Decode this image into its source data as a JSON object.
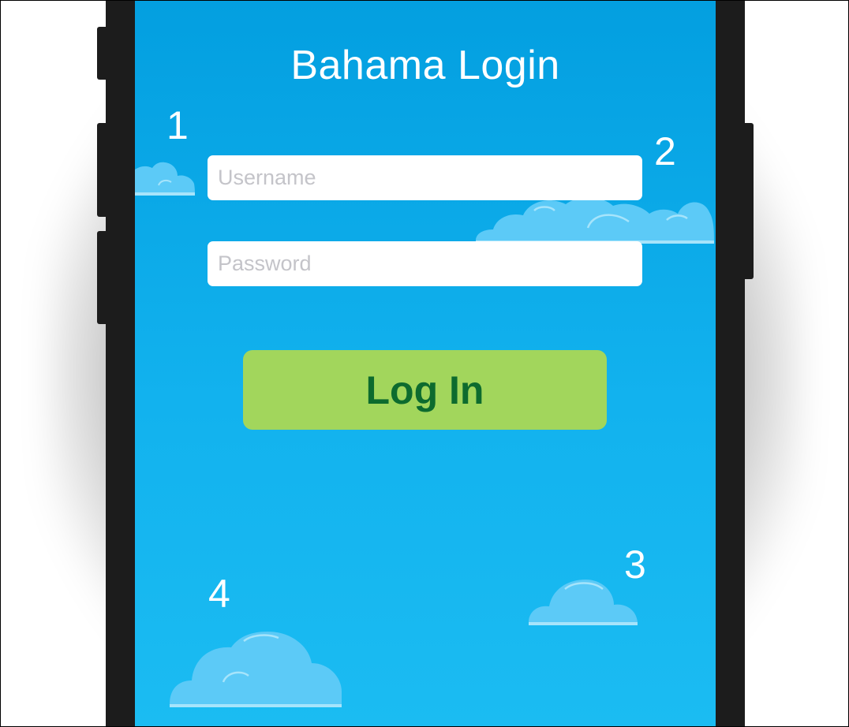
{
  "app": {
    "title": "Bahama Login"
  },
  "form": {
    "username_placeholder": "Username",
    "username_value": "",
    "password_placeholder": "Password",
    "password_value": "",
    "login_label": "Log In"
  },
  "clouds": [
    {
      "number": "1",
      "icon": "cloud-icon"
    },
    {
      "number": "2",
      "icon": "cloud-icon"
    },
    {
      "number": "3",
      "icon": "cloud-icon"
    },
    {
      "number": "4",
      "icon": "cloud-icon"
    }
  ],
  "colors": {
    "sky_top": "#039fe0",
    "sky_bottom": "#1bbcf2",
    "button_bg": "#a2d65c",
    "button_text": "#0d6b2e",
    "cloud_fill": "#5ccaf7",
    "cloud_edge": "#a6e4fb"
  }
}
